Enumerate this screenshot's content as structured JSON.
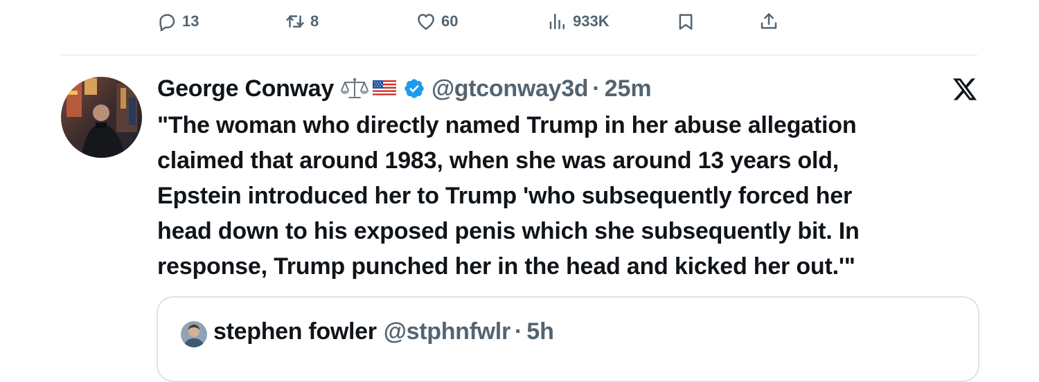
{
  "actions": {
    "reply_count": "13",
    "retweet_count": "8",
    "like_count": "60",
    "views_count": "933K"
  },
  "tweet": {
    "display_name": "George Conway",
    "name_emojis": [
      "balance-scale-emoji",
      "us-flag-emoji"
    ],
    "verified": true,
    "handle": "@gtconway3d",
    "separator": "·",
    "time": "25m",
    "text_lines": [
      "\"The woman who directly named Trump in her abuse allegation",
      "claimed that around 1983, when she was around 13 years old,",
      "Epstein introduced her to Trump 'who subsequently forced her",
      "head down to his exposed penis which she subsequently bit. In",
      "response, Trump punched her in the head and kicked her out.'\""
    ]
  },
  "quoted_tweet": {
    "display_name": "stephen fowler",
    "handle": "@stphnfwlr",
    "separator": "·",
    "time": "5h"
  },
  "icons": {
    "reply": "reply-icon",
    "retweet": "retweet-icon",
    "like": "heart-icon",
    "views": "views-icon",
    "bookmark": "bookmark-icon",
    "share": "share-icon",
    "platform": "x-logo-icon",
    "verified": "verified-badge-icon"
  },
  "colors": {
    "text_primary": "#0f1419",
    "text_secondary": "#536471",
    "verified_blue": "#1d9bf0",
    "divider": "#dfe3e6"
  }
}
